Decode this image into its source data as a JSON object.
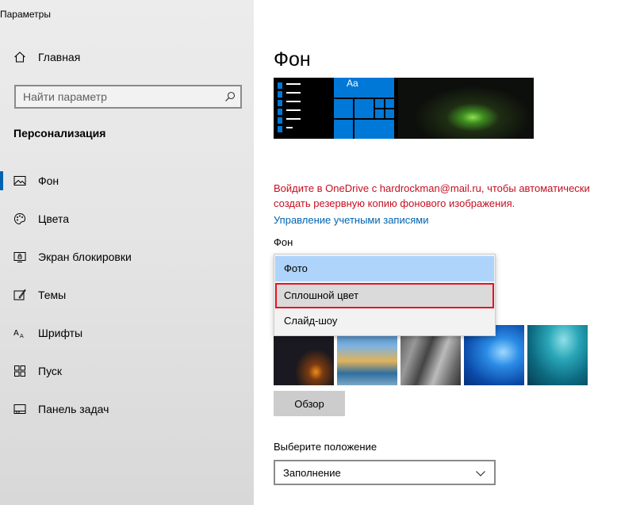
{
  "window": {
    "title": "Параметры"
  },
  "sidebar": {
    "home_label": "Главная",
    "search_placeholder": "Найти параметр",
    "section_title": "Персонализация",
    "items": [
      {
        "label": "Фон",
        "icon": "picture-icon",
        "active": true
      },
      {
        "label": "Цвета",
        "icon": "palette-icon",
        "active": false
      },
      {
        "label": "Экран блокировки",
        "icon": "lock-screen-icon",
        "active": false
      },
      {
        "label": "Темы",
        "icon": "themes-icon",
        "active": false
      },
      {
        "label": "Шрифты",
        "icon": "fonts-icon",
        "active": false
      },
      {
        "label": "Пуск",
        "icon": "start-icon",
        "active": false
      },
      {
        "label": "Панель задач",
        "icon": "taskbar-icon",
        "active": false
      }
    ]
  },
  "main": {
    "title": "Фон",
    "preview_tile_text": "Aa",
    "onedrive_notice": "Войдите в OneDrive с hardrockman@mail.ru, чтобы автоматически создать резервную копию фонового изображения.",
    "manage_accounts_link": "Управление учетными записями",
    "background_label": "Фон",
    "background_options": [
      "Фото",
      "Сплошной цвет",
      "Слайд-шоу"
    ],
    "background_selected": "Фото",
    "background_highlighted": "Сплошной цвет",
    "browse_button": "Обзор",
    "position_label": "Выберите положение",
    "position_value": "Заполнение"
  },
  "colors": {
    "accent": "#0078d7",
    "link": "#0063b1",
    "notice": "#c50f1f",
    "highlight_border": "#e81123",
    "selected_option": "#aed4fb"
  }
}
